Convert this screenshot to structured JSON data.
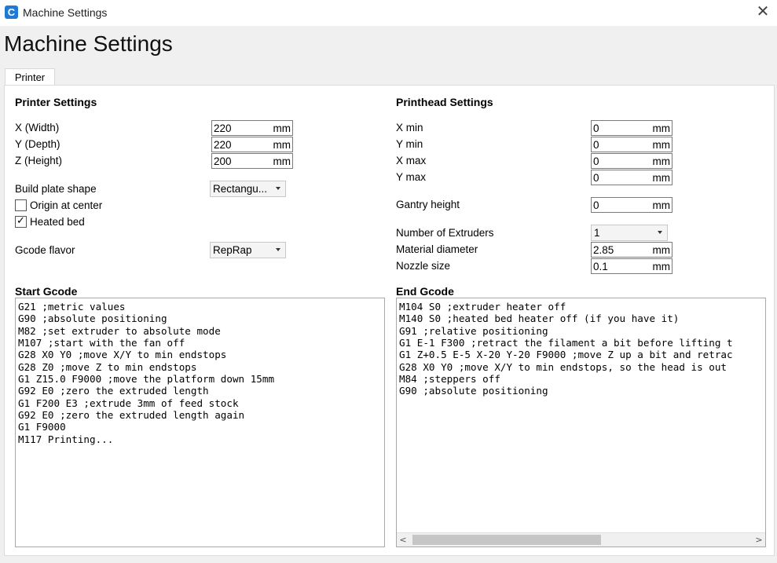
{
  "window": {
    "title": "Machine Settings",
    "close_glyph": "✕"
  },
  "heading": "Machine Settings",
  "tab": {
    "label": "Printer"
  },
  "printer_settings": {
    "title": "Printer Settings",
    "x": {
      "label": "X (Width)",
      "value": "220",
      "unit": "mm"
    },
    "y": {
      "label": "Y (Depth)",
      "value": "220",
      "unit": "mm"
    },
    "z": {
      "label": "Z (Height)",
      "value": "200",
      "unit": "mm"
    },
    "build_plate": {
      "label": "Build plate shape",
      "value": "Rectangu..."
    },
    "origin_center": {
      "label": "Origin at center",
      "checked": false
    },
    "heated_bed": {
      "label": "Heated bed",
      "checked": true,
      "mark": "✓"
    },
    "gcode_flavor": {
      "label": "Gcode flavor",
      "value": "RepRap"
    }
  },
  "printhead_settings": {
    "title": "Printhead Settings",
    "xmin": {
      "label": "X min",
      "value": "0",
      "unit": "mm"
    },
    "ymin": {
      "label": "Y min",
      "value": "0",
      "unit": "mm"
    },
    "xmax": {
      "label": "X max",
      "value": "0",
      "unit": "mm"
    },
    "ymax": {
      "label": "Y max",
      "value": "0",
      "unit": "mm"
    },
    "gantry": {
      "label": "Gantry height",
      "value": "0",
      "unit": "mm"
    },
    "extruders": {
      "label": "Number of Extruders",
      "value": "1"
    },
    "material": {
      "label": "Material diameter",
      "value": "2.85",
      "unit": "mm"
    },
    "nozzle": {
      "label": "Nozzle size",
      "value": "0.1",
      "unit": "mm"
    }
  },
  "start_gcode": {
    "title": "Start Gcode",
    "lines": [
      "G21 ;metric values",
      "G90 ;absolute positioning",
      "M82 ;set extruder to absolute mode",
      "M107 ;start with the fan off",
      "G28 X0 Y0 ;move X/Y to min endstops",
      "G28 Z0 ;move Z to min endstops",
      "G1 Z15.0 F9000 ;move the platform down 15mm",
      "G92 E0 ;zero the extruded length",
      "G1 F200 E3 ;extrude 3mm of feed stock",
      "G92 E0 ;zero the extruded length again",
      "G1 F9000",
      "M117 Printing..."
    ]
  },
  "end_gcode": {
    "title": "End Gcode",
    "lines": [
      "M104 S0 ;extruder heater off",
      "M140 S0 ;heated bed heater off (if you have it)",
      "G91 ;relative positioning",
      "G1 E-1 F300 ;retract the filament a bit before lifting t",
      "G1 Z+0.5 E-5 X-20 Y-20 F9000 ;move Z up a bit and retrac",
      "G28 X0 Y0 ;move X/Y to min endstops, so the head is out",
      "M84 ;steppers off",
      "G90 ;absolute positioning"
    ],
    "scroll_left": "<",
    "scroll_right": ">"
  }
}
